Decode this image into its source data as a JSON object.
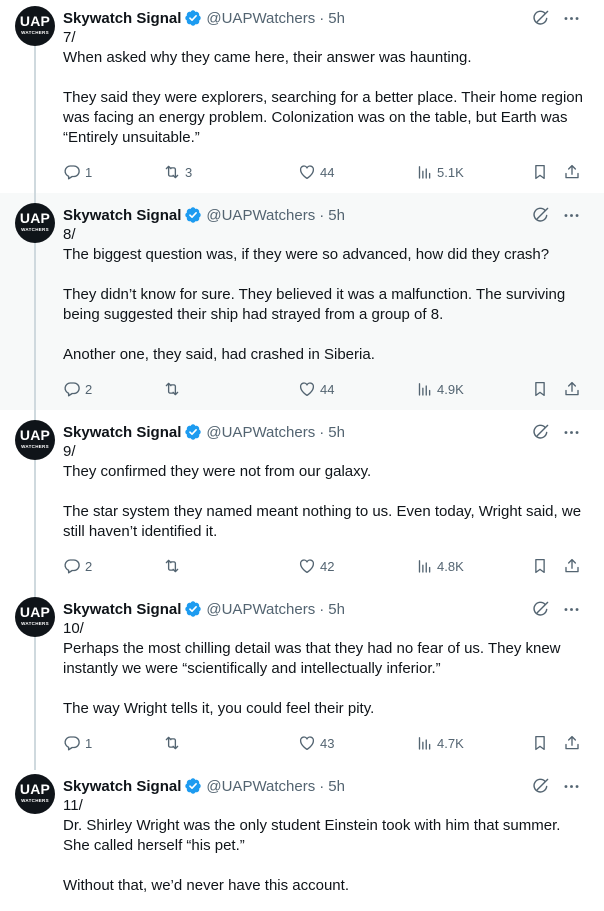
{
  "author": {
    "name": "Skywatch Signal",
    "handle": "@UAPWatchers",
    "time": "5h",
    "avatar_text": "UAP",
    "avatar_subtext": "WATCHERS",
    "verified_badge_color": "#1d9bf0"
  },
  "colors": {
    "text": "#0f1419",
    "secondary": "#536471",
    "thread_line": "#cfd9de",
    "shaded_background": "#f7f9f9"
  },
  "tweets": [
    {
      "number": "7/",
      "paragraphs": [
        "When asked why they came here, their answer was haunting.",
        "They said they were explorers, searching for a better place. Their home region was facing an energy problem. Colonization was on the table, but Earth was “Entirely unsuitable.”"
      ],
      "replies": "1",
      "reposts": "3",
      "likes": "44",
      "views": "5.1K"
    },
    {
      "number": "8/",
      "paragraphs": [
        "The biggest question was, if they were so advanced, how did they crash?",
        "They didn’t know for sure. They believed it was a malfunction. The surviving being suggested their ship had strayed from a group of 8.",
        "Another one, they said, had crashed in Siberia."
      ],
      "replies": "2",
      "reposts": "",
      "likes": "44",
      "views": "4.9K"
    },
    {
      "number": "9/",
      "paragraphs": [
        "They confirmed they were not from our galaxy.",
        "The star system they named meant nothing to us. Even today, Wright said, we still haven’t identified it."
      ],
      "replies": "2",
      "reposts": "",
      "likes": "42",
      "views": "4.8K"
    },
    {
      "number": "10/",
      "paragraphs": [
        "Perhaps the most chilling detail was that they had no fear of us. They knew instantly we were “scientifically and intellectually inferior.”",
        "The way Wright tells it, you could feel their pity."
      ],
      "replies": "1",
      "reposts": "",
      "likes": "43",
      "views": "4.7K"
    },
    {
      "number": "11/",
      "paragraphs": [
        "Dr. Shirley Wright was the only student Einstein took with him that summer. She called herself “his pet.”",
        "Without that, we’d never have this account."
      ]
    }
  ]
}
